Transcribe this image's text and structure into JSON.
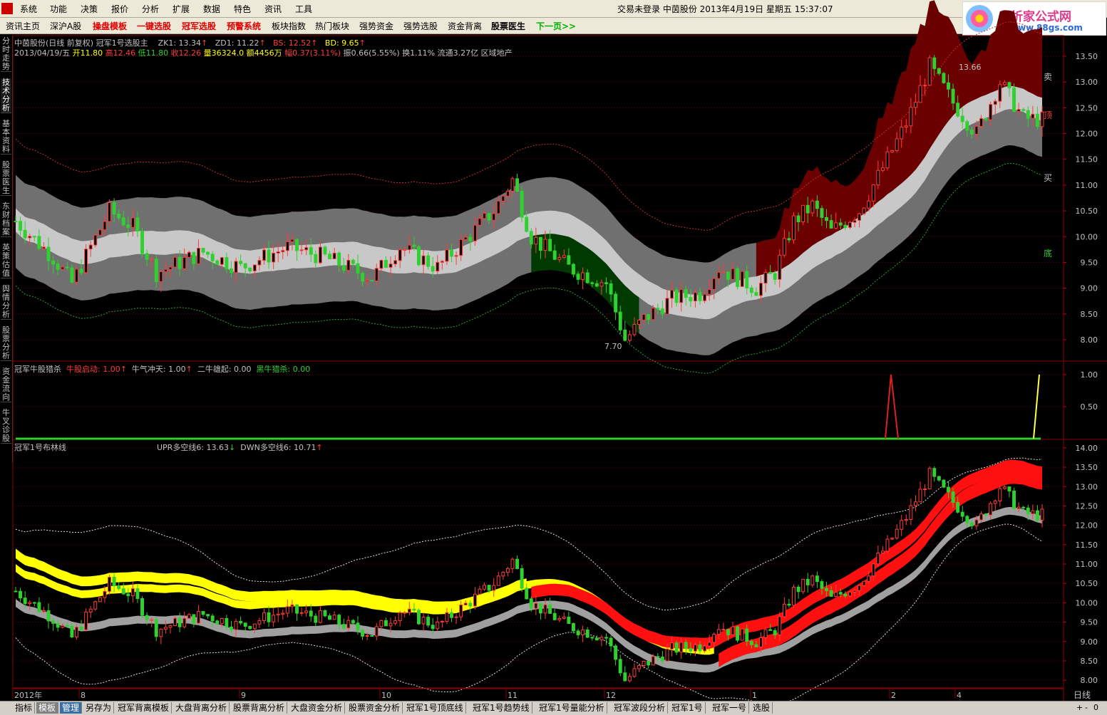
{
  "menu": {
    "items": [
      "系统",
      "功能",
      "决策",
      "报价",
      "分析",
      "扩展",
      "数据",
      "特色",
      "资讯",
      "工具"
    ],
    "status": "交易未登录  中茵股份  2013年4月19日  星期五  15:37:07"
  },
  "brand": {
    "title": "分析家公式网",
    "url": "www.88gs.com"
  },
  "toolbar": {
    "items": [
      {
        "label": "资讯主页",
        "style": ""
      },
      {
        "label": "深沪A股",
        "style": ""
      },
      {
        "label": "操盘模板",
        "style": "red"
      },
      {
        "label": "一键选股",
        "style": "red"
      },
      {
        "label": "冠军选股",
        "style": "red"
      },
      {
        "label": "预警系统",
        "style": "red"
      },
      {
        "label": "板块指数",
        "style": ""
      },
      {
        "label": "热门板块",
        "style": ""
      },
      {
        "label": "强势资金",
        "style": ""
      },
      {
        "label": "强势选股",
        "style": ""
      },
      {
        "label": "资金背离",
        "style": ""
      },
      {
        "label": "股票医生",
        "style": "bold"
      },
      {
        "label": "下一页>>",
        "style": "green"
      }
    ]
  },
  "sidetabs": [
    "分时走势",
    "技术分析",
    "基本资料",
    "股票医生",
    "东财档案",
    "英策估值",
    "舆情分析",
    "股票分析",
    "资金流向",
    "牛叉诊股"
  ],
  "info": {
    "line1": {
      "name": "中茵股份(日线 前复权) 冠军1号选股主",
      "zk1": "ZK1: 13.34",
      "zd1": "ZD1: 11.22",
      "bs": "BS: 12.52",
      "bd": "BD: 9.65"
    },
    "line2": {
      "date": "2013/04/19/五",
      "open": "开11.80",
      "high": "高12.46",
      "low": "低11.80",
      "close": "收12.26",
      "vol": "量36324.0",
      "amt": "额4456万",
      "chg": "幅0.37(3.11%)",
      "amp": "振0.66(5.55%)",
      "turn": "换1.11%",
      "float": "流通3.27亿",
      "sector": "区域地产"
    },
    "line3": {
      "name": "冠军牛股猎杀",
      "a": "牛股启动: 1.00",
      "b": "牛气冲天: 1.00",
      "c": "二牛雄起: 0.00",
      "d": "黑牛猎杀: 0.00"
    },
    "line4": {
      "name": "冠军1号布林线",
      "upr": "UPR多空线6: 13.63",
      "dwn": "DWN多空线6: 10.71"
    }
  },
  "chart_data": [
    {
      "type": "candlestick",
      "title": "中茵股份(日线 前复权) 冠军1号选股主",
      "yticks": [
        8.0,
        8.5,
        9.0,
        9.5,
        10.0,
        10.5,
        11.0,
        11.5,
        12.0,
        12.5,
        13.0,
        13.5
      ],
      "ylim": [
        7.6,
        13.9
      ],
      "annotations": {
        "high": "13.66",
        "low": "7.70"
      },
      "band_labels": [
        "卖",
        "顶",
        "买",
        "底"
      ],
      "date_range": [
        "2012/07",
        "2013/04/19"
      ],
      "last": {
        "open": 11.8,
        "high": 12.46,
        "low": 11.8,
        "close": 12.26
      }
    },
    {
      "type": "line",
      "title": "冠军牛股猎杀",
      "yticks": [
        0.5,
        1.0
      ],
      "ylim": [
        0,
        1.2
      ],
      "series": [
        {
          "name": "牛股启动",
          "values": [
            0,
            0,
            1,
            0
          ]
        },
        {
          "name": "牛气冲天",
          "values": [
            0,
            1
          ]
        },
        {
          "name": "二牛雄起",
          "values": [
            0
          ]
        },
        {
          "name": "黑牛猎杀",
          "values": [
            0
          ]
        }
      ]
    },
    {
      "type": "candlestick",
      "title": "冠军1号布林线",
      "yticks": [
        8.0,
        8.5,
        9.0,
        9.5,
        10.0,
        10.5,
        11.0,
        11.5,
        12.0,
        12.5,
        13.0,
        13.5,
        14.0
      ],
      "ylim": [
        7.8,
        14.2
      ],
      "series": [
        {
          "name": "UPR多空线6",
          "values": [
            13.63
          ]
        },
        {
          "name": "DWN多空线6",
          "values": [
            10.71
          ]
        }
      ]
    }
  ],
  "xaxis": {
    "labels": [
      "2012年",
      "8",
      "9",
      "10",
      "11",
      "12",
      "1",
      "2",
      "4"
    ],
    "period": "日线"
  },
  "bottom": {
    "items": [
      "指标",
      "模板",
      "管理",
      "另存为",
      "冠军背离模板",
      "大盘背离分析",
      "股票背离分析",
      "大盘资金分析",
      "股票资金分析",
      "冠军1号顶底线",
      "冠军1号趋势线",
      "冠军1号量能分析",
      "冠军波段分析",
      "冠军1号",
      "冠军一号",
      "选股"
    ],
    "right": [
      "+",
      "-",
      "0"
    ]
  },
  "colors": {
    "up": "#ff3c3c",
    "down": "#30d030",
    "ma": "#ff40ff",
    "band_gray": "#c0c0c0",
    "band_dark": "#707070",
    "sell_zone": "#6b0000",
    "buy_zone": "#003a00",
    "grid": "#8b0000"
  }
}
